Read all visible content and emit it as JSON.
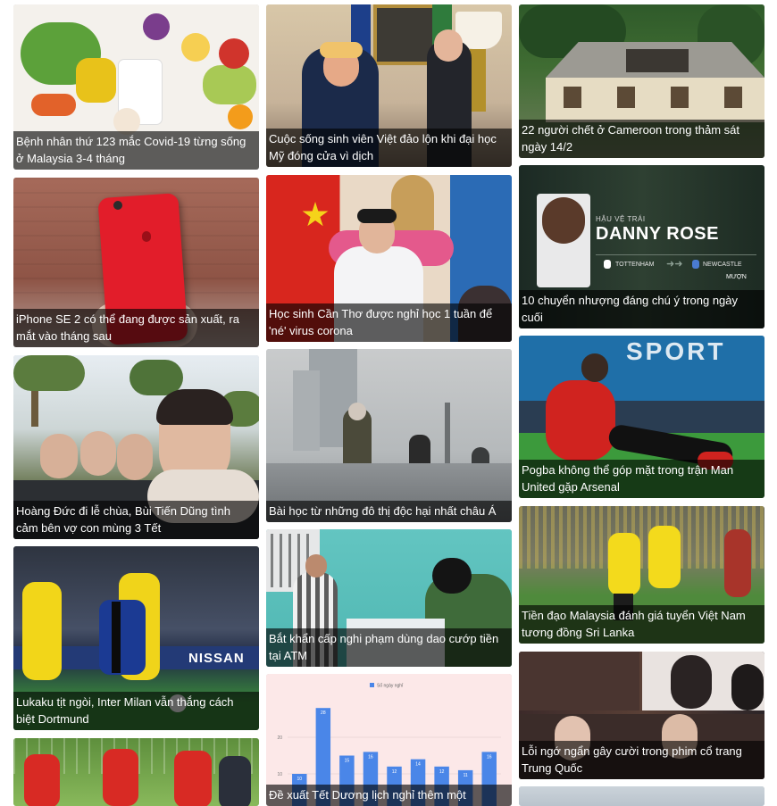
{
  "articles": [
    {
      "title": "Bệnh nhân thứ 123 mắc Covid-19 từng sống ở Malaysia 3-4 tháng",
      "image": "food-photo"
    },
    {
      "title": "Cuộc sống sinh viên Việt đảo lộn khi đại học Mỹ đóng cửa vì dịch",
      "image": "press-photo"
    },
    {
      "title": "22 người chết ở Cameroon trong thảm sát ngày 14/2",
      "image": "burned-house-photo"
    },
    {
      "title": "iPhone SE 2 có thể đang được sản xuất, ra mắt vào tháng sau",
      "image": "red-phone-photo"
    },
    {
      "title": "Học sinh Cần Thơ được nghỉ học 1 tuần để 'né' virus corona",
      "image": "meeting-photo"
    },
    {
      "title": "10 chuyển nhượng đáng chú ý trong ngày cuối",
      "image": "transfer-graphic",
      "graphic": {
        "kicker": "HẬU VỆ TRÁI",
        "name": "DANNY ROSE",
        "from": "TOTTENHAM",
        "to": "NEWCASTLE",
        "deal": "MƯỢN"
      }
    },
    {
      "title": "Hoàng Đức đi lễ chùa, Bùi Tiến Dũng tình cảm bên vợ con mùng 3 Tết",
      "image": "selfie-photo"
    },
    {
      "title": "Bài học từ những đô thị độc hại nhất châu Á",
      "image": "smog-city-photo"
    },
    {
      "title": "Pogba không thể góp mặt trong trận Man United gặp Arsenal",
      "image": "football-player-photo",
      "banner": "SPORT"
    },
    {
      "title": "Tiền đạo Malaysia đánh giá tuyển Việt Nam tương đồng Sri Lanka",
      "image": "football-match-photo"
    },
    {
      "title": "Bắt khẩn cấp nghi phạm dùng dao cướp tiền tại ATM",
      "image": "police-room-photo"
    },
    {
      "title": "Lukaku tịt ngòi, Inter Milan vẫn thắng cách biệt Dortmund",
      "image": "soccer-action-photo",
      "ad": "NISSAN"
    },
    {
      "title": "Lỗi ngớ ngẩn gây cười trong phim cổ trang Trung Quốc",
      "image": "drama-stills-photo"
    },
    {
      "title": "Đề xuất Tết Dương lịch nghỉ thêm một",
      "image": "bar-chart"
    },
    {
      "title": "",
      "image": "team-photo"
    },
    {
      "title": "",
      "image": "partial-photo"
    }
  ],
  "chart_data": {
    "type": "bar",
    "series": [
      {
        "name": "Số ngày nghỉ",
        "values": [
          10,
          28,
          15,
          16,
          12,
          14,
          12,
          11,
          16
        ]
      }
    ],
    "categories": [
      "",
      "",
      "",
      "",
      "",
      "",
      "",
      "",
      ""
    ],
    "yticks": [
      10,
      20
    ],
    "yticks_labels": [
      "10",
      "20"
    ],
    "ylim": [
      10,
      30
    ],
    "bar_color": "#4a86e8",
    "legend": "top-center"
  }
}
